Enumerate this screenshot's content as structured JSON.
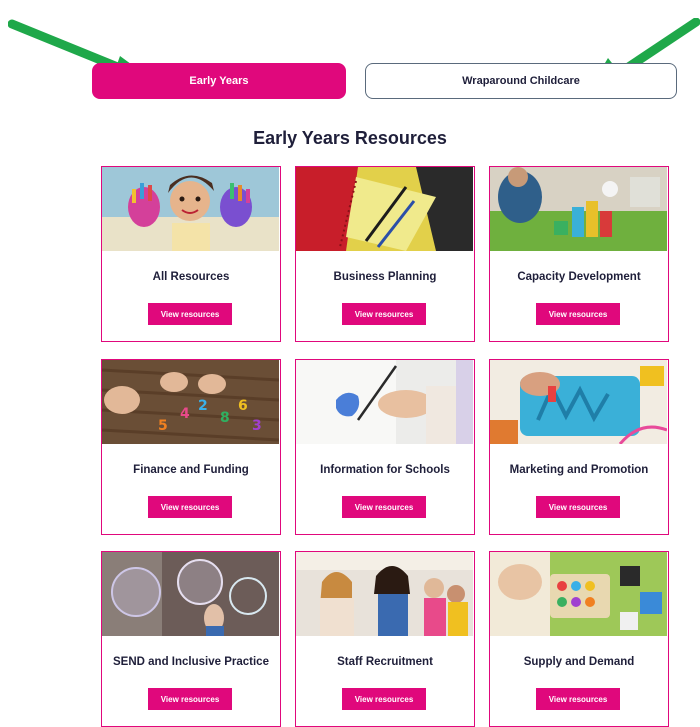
{
  "tabs": {
    "early_years": "Early Years",
    "wraparound": "Wraparound Childcare"
  },
  "section_title": "Early Years Resources",
  "button_label": "View resources",
  "cards": [
    {
      "title": "All Resources",
      "image": "child-painted-hands-photo"
    },
    {
      "title": "Business Planning",
      "image": "notebook-and-pens-photo"
    },
    {
      "title": "Capacity Development",
      "image": "children-playing-blocks-photo"
    },
    {
      "title": "Finance and Funding",
      "image": "number-magnets-table-photo"
    },
    {
      "title": "Information for Schools",
      "image": "child-painting-photo"
    },
    {
      "title": "Marketing and Promotion",
      "image": "sensory-tray-photo"
    },
    {
      "title": "SEND and Inclusive Practice",
      "image": "soap-bubbles-photo"
    },
    {
      "title": "Staff Recruitment",
      "image": "teacher-with-children-photo"
    },
    {
      "title": "Supply and Demand",
      "image": "toddler-toys-photo"
    }
  ],
  "colors": {
    "accent": "#e0087c",
    "arrow": "#1fa84a",
    "heading": "#1f1f3a",
    "outline": "#5a6a7c"
  }
}
